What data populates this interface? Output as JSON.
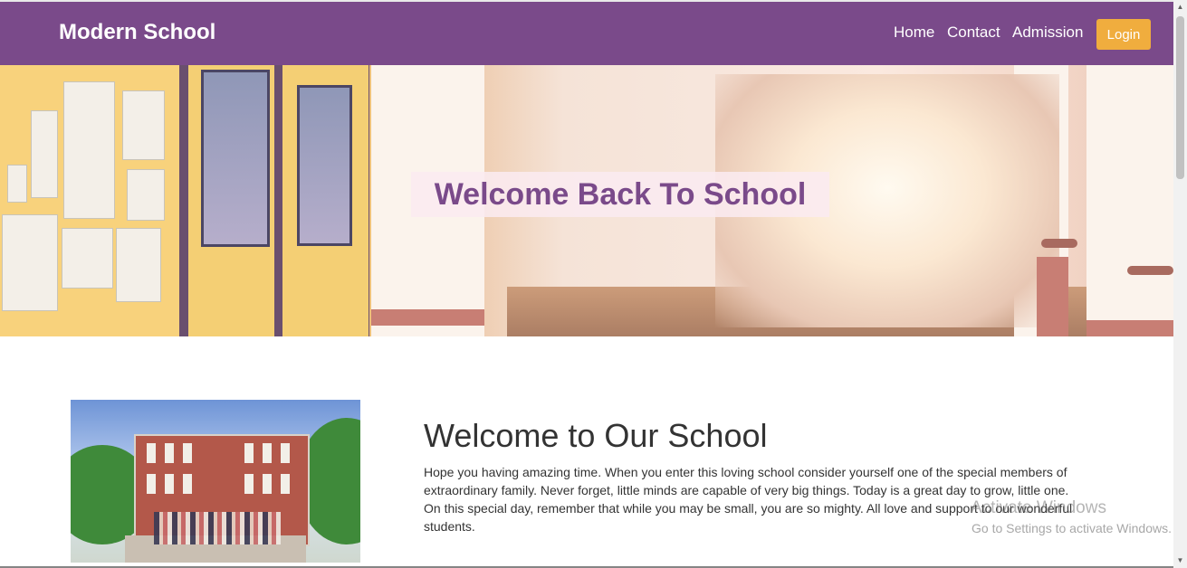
{
  "navbar": {
    "brand": "Modern School",
    "links": [
      "Home",
      "Contact",
      "Admission"
    ],
    "login_label": "Login",
    "background_color": "#7a4a8a",
    "login_color": "#f0ad3e"
  },
  "hero": {
    "title": "Welcome Back To School"
  },
  "content": {
    "title": "Welcome to Our School",
    "text": "Hope you having amazing time. When you enter this loving school consider yourself one of the special members of extraordinary family. Never forget, little minds are capable of very big things. Today is a great day to grow, little one. On this special day, remember that while you may be small, you are so mighty. All love and support to our wonderful students."
  },
  "watermark": {
    "title": "Activate Windows",
    "subtitle": "Go to Settings to activate Windows."
  },
  "icons": {
    "scroll_up": "scroll-up-arrow",
    "scroll_down": "scroll-down-arrow"
  }
}
